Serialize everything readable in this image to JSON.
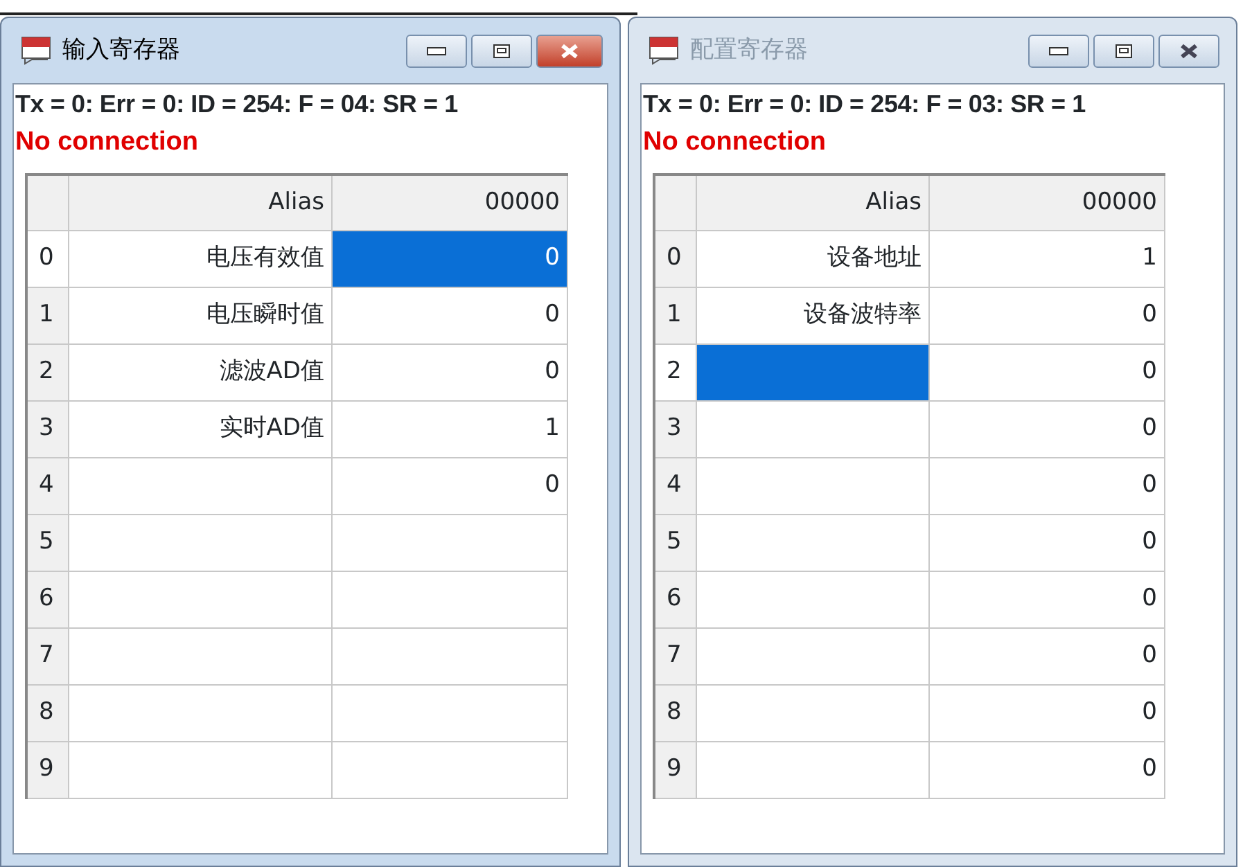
{
  "windows": [
    {
      "title": "输入寄存器",
      "active": true,
      "status_line": "Tx = 0: Err = 0: ID = 254: F = 04: SR = 1",
      "connection": "No connection",
      "columns": [
        "Alias",
        "00000"
      ],
      "rows": [
        {
          "index": "0",
          "selected": true,
          "alias": {
            "text": "电压有效值",
            "selected": false
          },
          "value": {
            "text": "0",
            "selected": true
          }
        },
        {
          "index": "1",
          "selected": false,
          "alias": {
            "text": "电压瞬时值",
            "selected": false
          },
          "value": {
            "text": "0",
            "selected": false
          }
        },
        {
          "index": "2",
          "selected": false,
          "alias": {
            "text": "滤波AD值",
            "selected": false
          },
          "value": {
            "text": "0",
            "selected": false
          }
        },
        {
          "index": "3",
          "selected": false,
          "alias": {
            "text": "实时AD值",
            "selected": false
          },
          "value": {
            "text": "1",
            "selected": false
          }
        },
        {
          "index": "4",
          "selected": false,
          "alias": {
            "selected": false
          },
          "value": {
            "text": "0",
            "selected": false
          }
        },
        {
          "index": "5",
          "selected": false,
          "alias": {
            "selected": false
          },
          "value": {
            "selected": false
          }
        },
        {
          "index": "6",
          "selected": false,
          "alias": {
            "selected": false
          },
          "value": {
            "selected": false
          }
        },
        {
          "index": "7",
          "selected": false,
          "alias": {
            "selected": false
          },
          "value": {
            "selected": false
          }
        },
        {
          "index": "8",
          "selected": false,
          "alias": {
            "selected": false
          },
          "value": {
            "selected": false
          }
        },
        {
          "index": "9",
          "selected": false,
          "alias": {
            "selected": false
          },
          "value": {
            "selected": false
          }
        }
      ]
    },
    {
      "title": "配置寄存器",
      "active": false,
      "status_line": "Tx = 0: Err = 0: ID = 254: F = 03: SR = 1",
      "connection": "No connection",
      "columns": [
        "Alias",
        "00000"
      ],
      "rows": [
        {
          "index": "0",
          "selected": false,
          "alias": {
            "text": "设备地址",
            "selected": false
          },
          "value": {
            "text": "1",
            "selected": false
          }
        },
        {
          "index": "1",
          "selected": false,
          "alias": {
            "text": "设备波特率",
            "selected": false
          },
          "value": {
            "text": "0",
            "selected": false
          }
        },
        {
          "index": "2",
          "selected": true,
          "alias": {
            "selected": true
          },
          "value": {
            "text": "0",
            "selected": false
          }
        },
        {
          "index": "3",
          "selected": false,
          "alias": {
            "selected": false
          },
          "value": {
            "text": "0",
            "selected": false
          }
        },
        {
          "index": "4",
          "selected": false,
          "alias": {
            "selected": false
          },
          "value": {
            "text": "0",
            "selected": false
          }
        },
        {
          "index": "5",
          "selected": false,
          "alias": {
            "selected": false
          },
          "value": {
            "text": "0",
            "selected": false
          }
        },
        {
          "index": "6",
          "selected": false,
          "alias": {
            "selected": false
          },
          "value": {
            "text": "0",
            "selected": false
          }
        },
        {
          "index": "7",
          "selected": false,
          "alias": {
            "selected": false
          },
          "value": {
            "text": "0",
            "selected": false
          }
        },
        {
          "index": "8",
          "selected": false,
          "alias": {
            "selected": false
          },
          "value": {
            "text": "0",
            "selected": false
          }
        },
        {
          "index": "9",
          "selected": false,
          "alias": {
            "selected": false
          },
          "value": {
            "text": "0",
            "selected": false
          }
        }
      ]
    }
  ]
}
